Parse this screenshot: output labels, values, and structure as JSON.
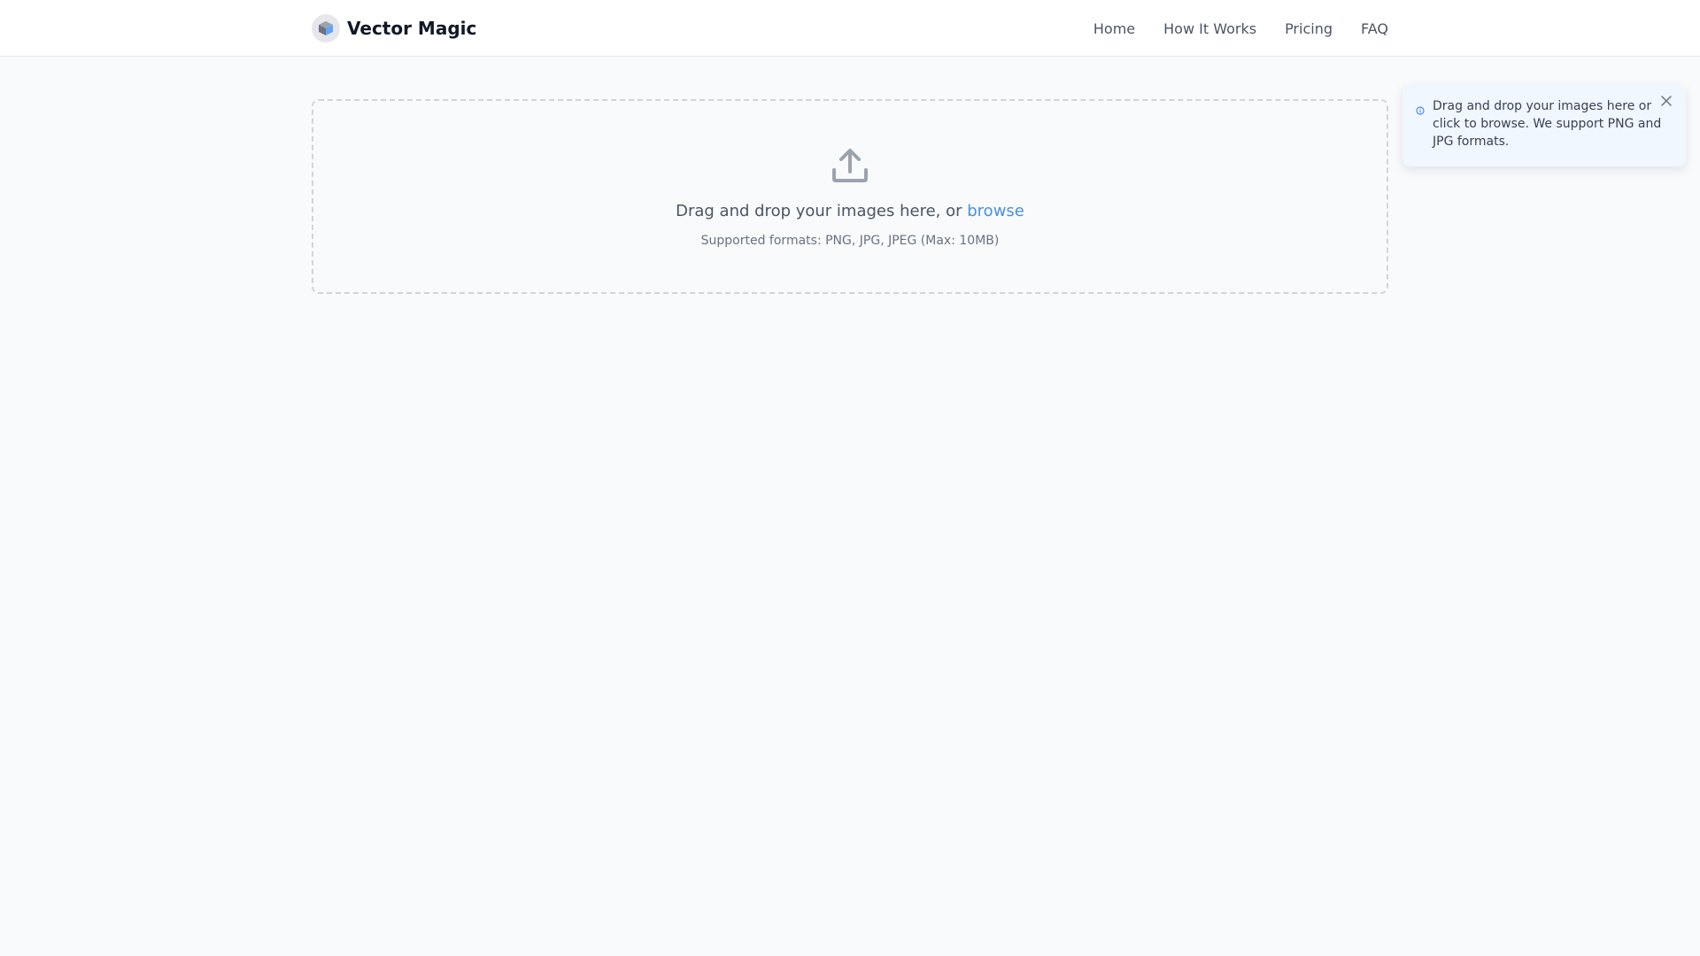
{
  "header": {
    "brand": "Vector Magic",
    "nav": [
      {
        "label": "Home"
      },
      {
        "label": "How It Works"
      },
      {
        "label": "Pricing"
      },
      {
        "label": "FAQ"
      }
    ]
  },
  "dropzone": {
    "text": "Drag and drop your images here, or",
    "browse_label": "browse",
    "formats": "Supported formats: PNG, JPG, JPEG (Max: 10MB)"
  },
  "toast": {
    "message": "Drag and drop your images here or click to browse. We support PNG and JPG formats."
  },
  "colors": {
    "accent": "#4a90d9",
    "background": "#f8fafc",
    "toast_background": "#f0f7ff"
  },
  "icons": {
    "logo": "cube-logo-icon",
    "upload": "upload-icon",
    "info": "info-icon",
    "close": "close-icon"
  }
}
